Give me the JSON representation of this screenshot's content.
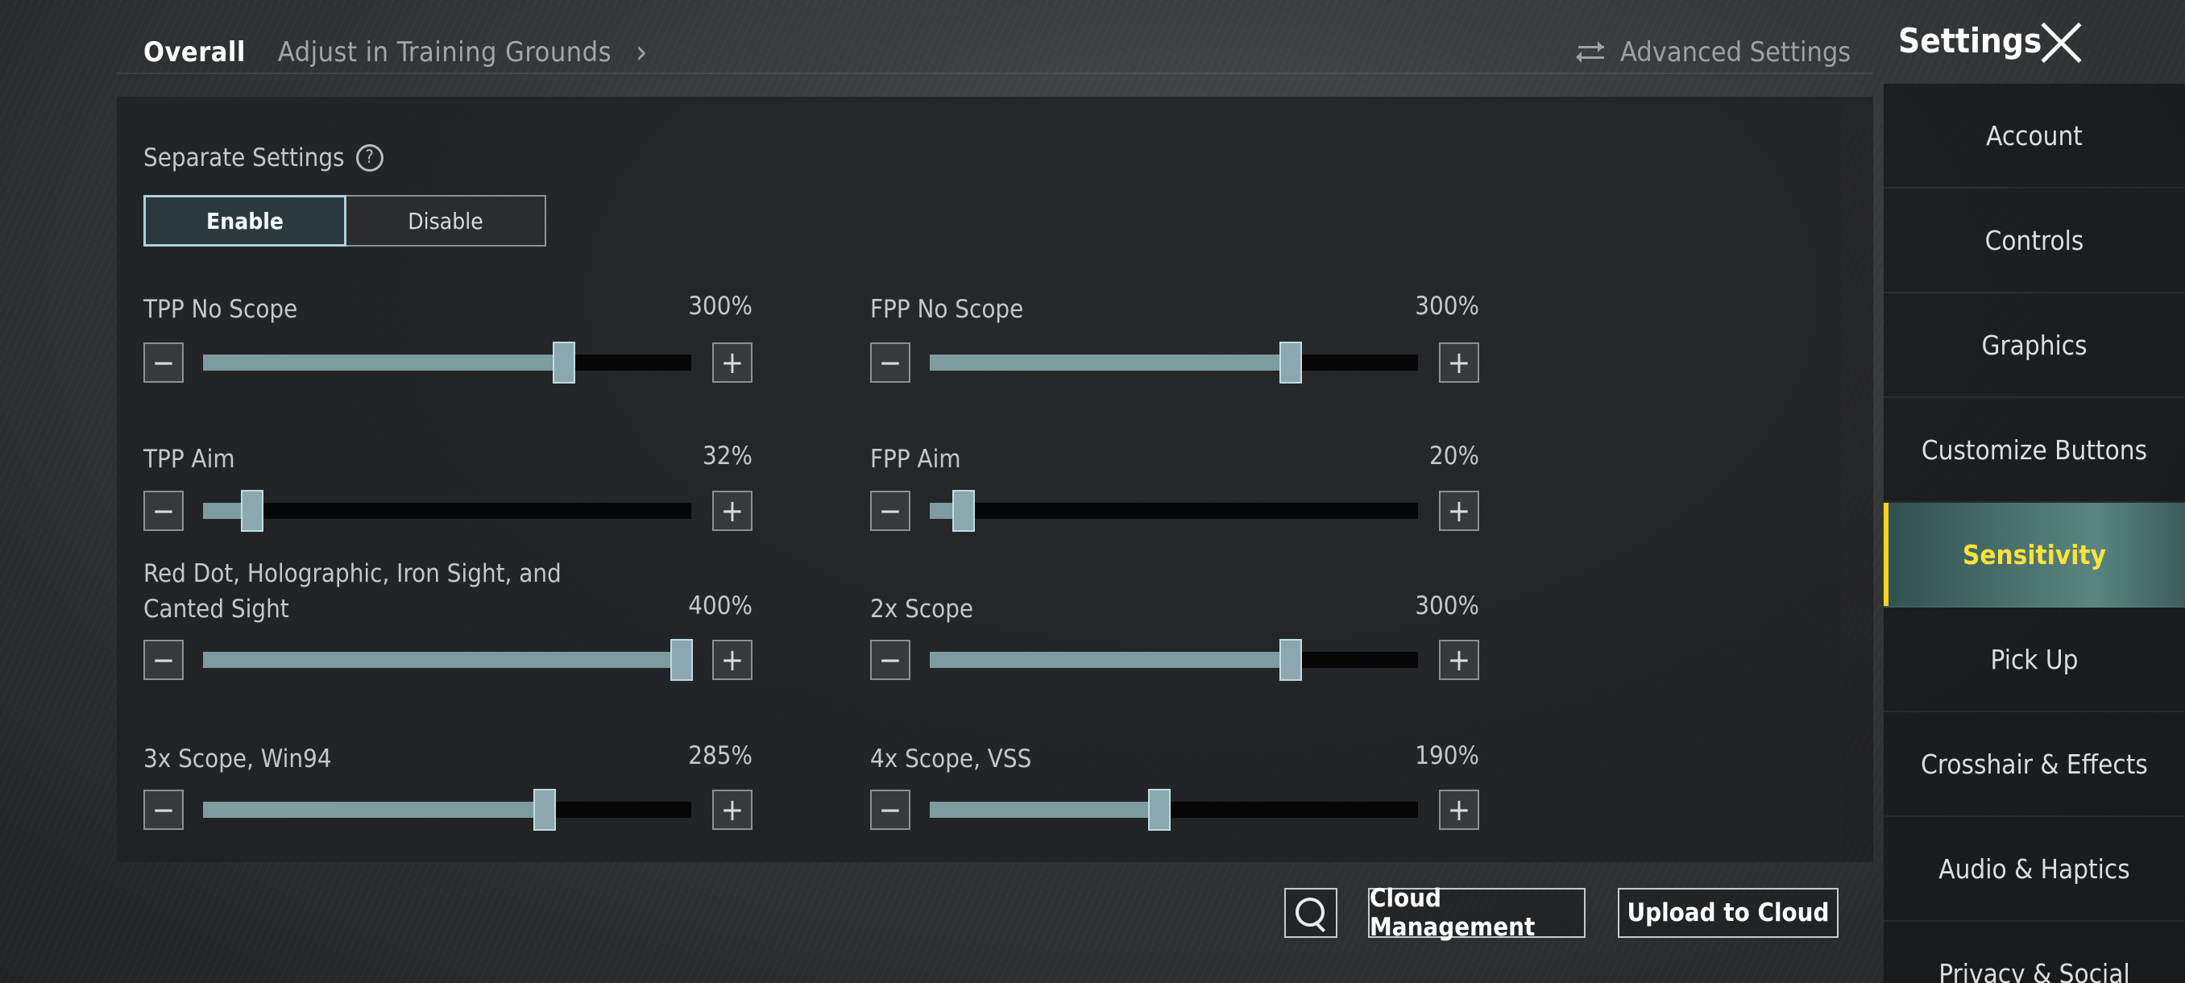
{
  "top_tabs": {
    "overall": "Overall",
    "training": "Adjust in Training Grounds"
  },
  "advanced_settings": "Advanced Settings",
  "settings_title": "Settings",
  "separate_settings": {
    "label": "Separate Settings",
    "help_glyph": "?",
    "enable": "Enable",
    "disable": "Disable",
    "selected": "Enable"
  },
  "sliders": [
    {
      "label": "TPP No Scope",
      "value": "300%",
      "fraction": 0.74
    },
    {
      "label": "FPP No Scope",
      "value": "300%",
      "fraction": 0.74
    },
    {
      "label": "TPP Aim",
      "value": "32%",
      "fraction": 0.1
    },
    {
      "label": "FPP Aim",
      "value": "20%",
      "fraction": 0.07
    },
    {
      "label": "Red Dot, Holographic, Iron Sight, and Canted Sight",
      "value": "400%",
      "fraction": 0.98
    },
    {
      "label": "2x Scope",
      "value": "300%",
      "fraction": 0.74
    },
    {
      "label": "3x Scope, Win94",
      "value": "285%",
      "fraction": 0.7
    },
    {
      "label": "4x Scope, VSS",
      "value": "190%",
      "fraction": 0.47
    }
  ],
  "buttons": {
    "minus": "−",
    "plus": "+",
    "cloud_management": "Cloud Management",
    "upload_to_cloud": "Upload to Cloud"
  },
  "sidebar": {
    "items": [
      {
        "label": "Account"
      },
      {
        "label": "Controls"
      },
      {
        "label": "Graphics"
      },
      {
        "label": "Customize Buttons"
      },
      {
        "label": "Sensitivity"
      },
      {
        "label": "Pick Up"
      },
      {
        "label": "Crosshair & Effects"
      },
      {
        "label": "Audio & Haptics"
      },
      {
        "label": "Privacy & Social"
      }
    ],
    "active": "Sensitivity"
  },
  "colors": {
    "active_tab_text": "#ffe23a",
    "slider_fill": "#7e9ba0",
    "enable_border": "#a9d3d8"
  }
}
